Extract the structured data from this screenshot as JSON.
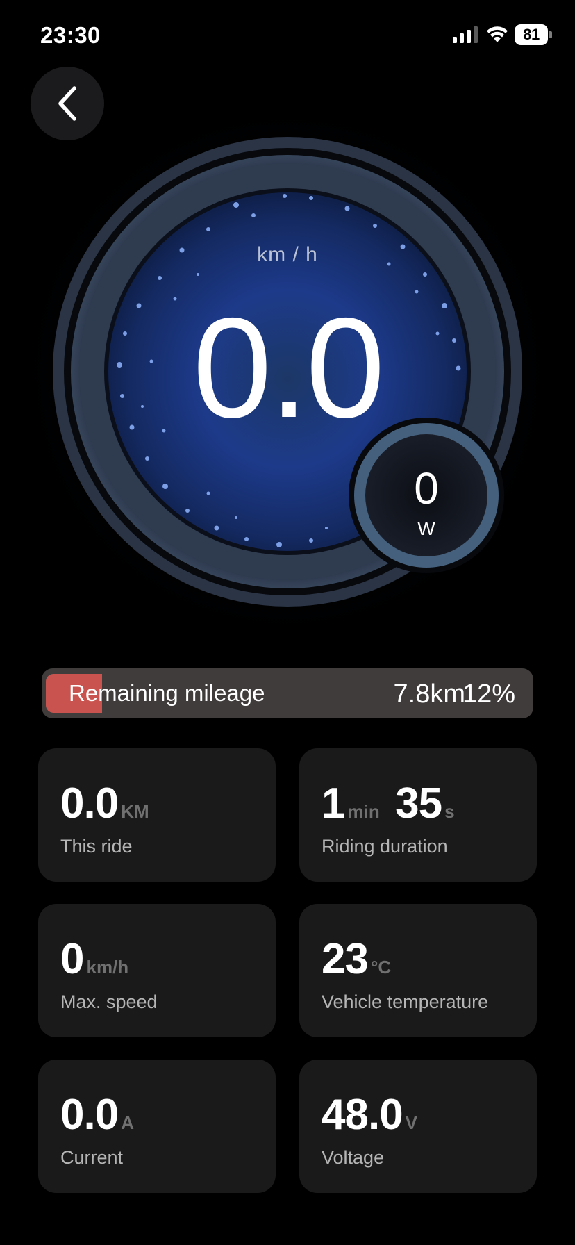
{
  "status_bar": {
    "time": "23:30",
    "battery_percent": "81",
    "signal_icon": "cellular-signal-icon",
    "wifi_icon": "wifi-icon"
  },
  "nav": {
    "back_icon": "chevron-left-icon"
  },
  "gauge": {
    "speed_unit": "km / h",
    "speed_value": "0.0",
    "power_value": "0",
    "power_unit": "W"
  },
  "mileage": {
    "label": "Remaining mileage",
    "distance": "7.8km",
    "percent_text": "12%",
    "battery_fraction": 0.12,
    "fill_color": "#c9544f"
  },
  "stats": [
    {
      "value": "0.0",
      "unit": "KM",
      "label": "This ride"
    },
    {
      "value": "1",
      "unit": "min",
      "value2": "35",
      "unit2": "s",
      "label": "Riding duration"
    },
    {
      "value": "0",
      "unit": "km/h",
      "label": "Max. speed"
    },
    {
      "value": "23",
      "unit": "°C",
      "label": "Vehicle temperature"
    },
    {
      "value": "0.0",
      "unit": "A",
      "label": "Current"
    },
    {
      "value": "48.0",
      "unit": "V",
      "label": "Voltage"
    }
  ],
  "colors": {
    "background": "#000000",
    "card": "#1a1a1a",
    "gauge_blue": "#1d3a8a",
    "ring": "#2b3444"
  }
}
